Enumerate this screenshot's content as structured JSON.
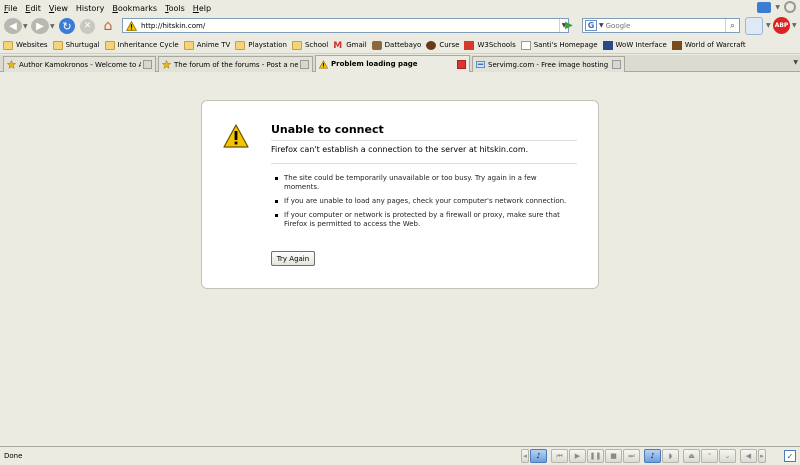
{
  "menu": [
    {
      "key": "F",
      "rest": "ile"
    },
    {
      "key": "E",
      "rest": "dit"
    },
    {
      "key": "V",
      "rest": "iew"
    },
    {
      "key": "",
      "rest": "History"
    },
    {
      "key": "B",
      "rest": "ookmarks"
    },
    {
      "key": "T",
      "rest": "ools"
    },
    {
      "key": "H",
      "rest": "elp"
    }
  ],
  "navigation": {
    "url": "http://hitskin.com/",
    "search_placeholder": "Google",
    "search_engine_letter": "G",
    "addon_label": "ABP"
  },
  "bookmarks": [
    {
      "label": "Websites",
      "icon": "folder-icon"
    },
    {
      "label": "Shurtugal",
      "icon": "folder-icon"
    },
    {
      "label": "Inheritance Cycle",
      "icon": "folder-icon"
    },
    {
      "label": "Anime TV",
      "icon": "folder-icon"
    },
    {
      "label": "Playstation",
      "icon": "folder-icon"
    },
    {
      "label": "School",
      "icon": "folder-icon"
    },
    {
      "label": "Gmail",
      "icon": "gmail-icon"
    },
    {
      "label": "Dattebayo",
      "icon": "dattebayo-icon"
    },
    {
      "label": "Curse",
      "icon": "curse-icon"
    },
    {
      "label": "W3Schools",
      "icon": "w3schools-icon"
    },
    {
      "label": "Santi's Homepage",
      "icon": "page-icon"
    },
    {
      "label": "WoW Interface",
      "icon": "wowinterface-icon"
    },
    {
      "label": "World of Warcraft",
      "icon": "wow-icon"
    }
  ],
  "tabs": [
    {
      "label": "Author Kamokronos - Welcome to Adm...",
      "active": false
    },
    {
      "label": "The forum of the forums - Post a new ...",
      "active": false
    },
    {
      "label": "Problem loading page",
      "active": true
    },
    {
      "label": "Servimg.com - Free image hosting ser...",
      "active": false
    }
  ],
  "error": {
    "title": "Unable to connect",
    "short": "Firefox can't establish a connection to the server at hitskin.com.",
    "items": [
      "The site could be temporarily unavailable or too busy. Try again in a few moments.",
      "If you are unable to load any pages, check your computer's network connection.",
      "If your computer or network is protected by a firewall or proxy, make sure that Firefox is permitted to access the Web."
    ],
    "button": "Try Again"
  },
  "status": {
    "text": "Done"
  },
  "colors": {
    "chrome": "#ecebe2",
    "accent": "#3b7ad6",
    "warning": "#f2c200"
  }
}
